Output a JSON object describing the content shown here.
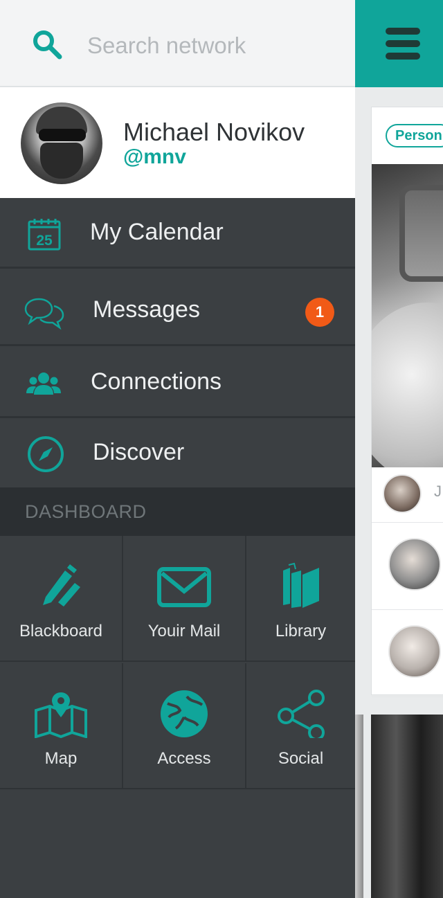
{
  "search": {
    "placeholder": "Search network"
  },
  "profile": {
    "name": "Michael Novikov",
    "handle": "@mnv"
  },
  "nav": {
    "items": [
      {
        "label": "My Calendar",
        "icon": "calendar-icon",
        "icon_text": "25"
      },
      {
        "label": "Messages",
        "icon": "chat-bubbles-icon",
        "badge": "1"
      },
      {
        "label": "Connections",
        "icon": "people-icon"
      },
      {
        "label": "Discover",
        "icon": "compass-icon"
      }
    ]
  },
  "dashboard": {
    "header": "DASHBOARD",
    "tiles": [
      {
        "label": "Blackboard",
        "icon": "pencil-icon"
      },
      {
        "label": "Youir Mail",
        "icon": "mail-icon"
      },
      {
        "label": "Library",
        "icon": "books-icon"
      },
      {
        "label": "Map",
        "icon": "map-icon"
      },
      {
        "label": "Access",
        "icon": "globe-icon"
      },
      {
        "label": "Social",
        "icon": "share-icon"
      }
    ]
  },
  "feed": {
    "chip": "Person",
    "author_initial": "J"
  },
  "colors": {
    "accent": "#10a59a",
    "drawer_bg": "#3b3f42",
    "badge": "#f15a17"
  }
}
